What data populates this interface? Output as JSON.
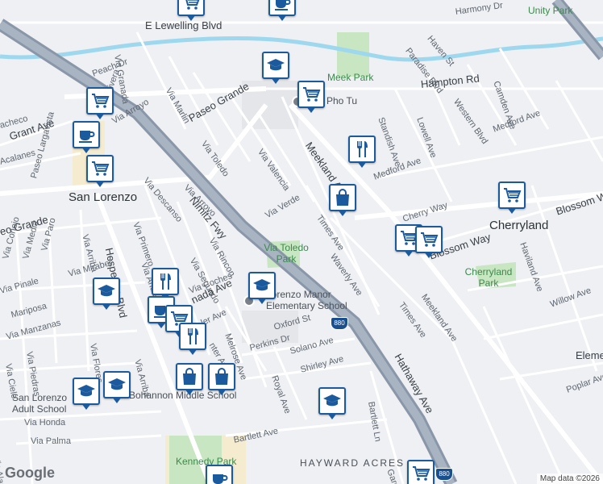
{
  "map": {
    "places": {
      "san_lorenzo": "San Lorenzo",
      "cherryland": "Cherryland",
      "hayward_acres": "HAYWARD ACRES",
      "unity_park": "Unity Park",
      "meek_park": "Meek Park",
      "via_toledo_park": "Via Toledo Park",
      "cherryland_park": "Cherryland Park",
      "kennedy_park": "Kennedy Park",
      "school_1": "Lorenzo Manor Elementary School",
      "school_2": "San Lorenzo Adult School",
      "school_3": "Bohannon Middle School",
      "restaurant_1": "Pho Tu"
    },
    "streets": {
      "lewelling": "E Lewelling Blvd",
      "harmony": "Harmony Dr",
      "haven": "Haven St",
      "paradise": "Paradise Blvd",
      "hampton": "Hampton Rd",
      "western": "Western Blvd",
      "camden": "Camden Ave",
      "standish": "Standish Ave",
      "lowell": "Lowell Ave",
      "medford_1": "Medford Ave",
      "medford_2": "Medford Ave",
      "meekland_1": "Meekland Ave",
      "meekland_2": "Meekland Ave",
      "via_granada": "Via Granada",
      "peach": "Peach Dr",
      "via_rivera": "Via Rivera",
      "via_arroyo_1": "Via Arroyo",
      "via_arroyo_2": "Via Arroyo",
      "via_marlin": "Via Marlin",
      "paseo_grande_1": "Paseo Grande",
      "paseo_grande_2": "eo Grande",
      "grant": "Grant Ave",
      "pacheco": "acheco",
      "paseo_largavista": "Paseo Largavista",
      "acalanes": "Acalanes",
      "via_toledo": "Via Toledo",
      "via_valencia": "Via Valencia",
      "via_descanso": "Via Descanso",
      "nimitz": "Nimitz Fwy",
      "via_verde": "Via Verde",
      "times_1": "Times Ave",
      "times_2": "Times Ave",
      "waverly": "Waverly Ave",
      "blossom_1": "Blossom Way",
      "blossom_2": "Blossom W",
      "cherry": "Cherry Way",
      "haviland": "Haviland Ave",
      "willow": "Willow Ave",
      "poplar": "Poplar Ave",
      "hathaway": "Hathaway Ave",
      "hesperian": "Hesperian Blvd",
      "via_arriba_1": "Via Arriba",
      "via_arriba_2": "Via Arriba",
      "via_conejo": "Via Conejo",
      "via_media": "Via Media",
      "via_paro": "Via Paro",
      "via_primero": "Via Primero",
      "via_rincon": "Via Rincon",
      "via_segundo": "Via Segundo",
      "via_mirabel": "Via Mirabel",
      "via_pinale": "Via Pinale",
      "mariposa": "Mariposa",
      "via_manzanas": "Via Manzanas",
      "via_piedras": "Via Piedras",
      "via_cielo": "Via Cielo",
      "via_flores": "Via Flores",
      "via_coches": "Via Coches",
      "granada_ave": "nada Ave",
      "melrose": "Melrose Ave",
      "oxford": "Oxford St",
      "perkins": "Perkins Dr",
      "solano": "Solano Ave",
      "shirley": "Shirley Ave",
      "royal": "Royal Ave",
      "bartlett_1": "Bartlett Ave",
      "bartlett_2": "Bartlett Ln",
      "via_honda": "Via Honda",
      "via_palma": "Via Palma",
      "via_alamitos": "Via Alamitos",
      "garden": "Garde",
      "hunter": "nter Ave",
      "ler": "ler Ave",
      "via_ander": "Via Ande",
      "elem": "Eleme"
    },
    "freeway_shield": "880",
    "google_logo": "Google",
    "attribution": "Map data ©2026"
  },
  "markers": [
    {
      "type": "grocery",
      "icon": "shopping-cart-icon"
    },
    {
      "type": "coffee",
      "icon": "coffee-cup-icon"
    },
    {
      "type": "grocery",
      "icon": "shopping-cart-icon"
    },
    {
      "type": "school",
      "icon": "graduation-cap-icon"
    },
    {
      "type": "grocery",
      "icon": "shopping-cart-icon"
    },
    {
      "type": "coffee",
      "icon": "coffee-cup-icon"
    },
    {
      "type": "grocery",
      "icon": "shopping-cart-icon"
    },
    {
      "type": "restaurant",
      "icon": "fork-knife-icon"
    },
    {
      "type": "shopping",
      "icon": "shopping-bag-icon"
    },
    {
      "type": "grocery",
      "icon": "shopping-cart-icon"
    },
    {
      "type": "grocery",
      "icon": "shopping-cart-icon"
    },
    {
      "type": "grocery",
      "icon": "shopping-cart-icon"
    },
    {
      "type": "school",
      "icon": "graduation-cap-icon"
    },
    {
      "type": "school",
      "icon": "graduation-cap-icon"
    },
    {
      "type": "restaurant",
      "icon": "fork-knife-icon"
    },
    {
      "type": "coffee",
      "icon": "coffee-cup-icon"
    },
    {
      "type": "grocery",
      "icon": "shopping-cart-icon"
    },
    {
      "type": "restaurant",
      "icon": "fork-knife-icon"
    },
    {
      "type": "shopping",
      "icon": "shopping-bag-icon"
    },
    {
      "type": "shopping",
      "icon": "shopping-bag-icon"
    },
    {
      "type": "school",
      "icon": "graduation-cap-icon"
    },
    {
      "type": "school",
      "icon": "graduation-cap-icon"
    },
    {
      "type": "school",
      "icon": "graduation-cap-icon"
    },
    {
      "type": "coffee",
      "icon": "coffee-cup-icon"
    },
    {
      "type": "grocery",
      "icon": "shopping-cart-icon"
    }
  ],
  "colors": {
    "background": "#eef0f3",
    "road": "#ffffff",
    "freeway": "#9aa6b6",
    "park": "#c7e6c1",
    "water": "#9ed8ee",
    "marker_border": "#1c5a9e"
  }
}
